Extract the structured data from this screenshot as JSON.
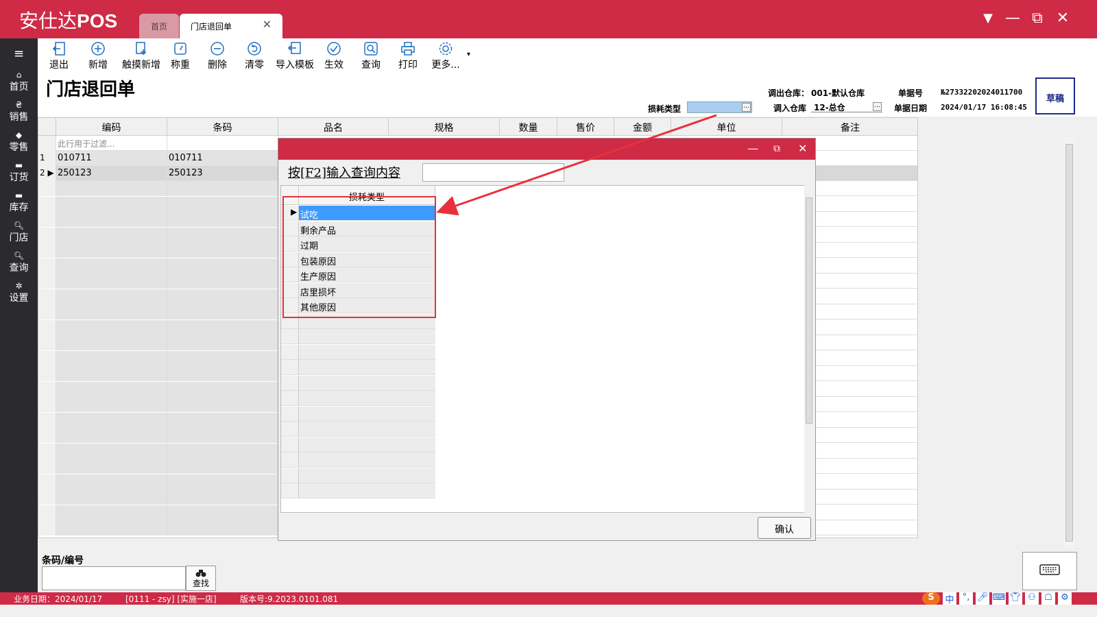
{
  "app": {
    "title_cn": "安仕达",
    "title_en": "POS",
    "tabs": [
      {
        "label": "首页"
      },
      {
        "label": "门店退回单"
      }
    ],
    "tab_close": "✕",
    "window_buttons": {
      "menu": "▼",
      "minimize": "—",
      "restore": "⧉",
      "close": "✕"
    }
  },
  "sidebar": {
    "menu_icon": "≡",
    "items": [
      {
        "label": "首页",
        "icon": "home-icon",
        "glyph": "⌂"
      },
      {
        "label": "销售",
        "icon": "currency-icon",
        "glyph": "₴"
      },
      {
        "label": "零售",
        "icon": "tag-icon",
        "glyph": "◆"
      },
      {
        "label": "订货",
        "icon": "cart-icon",
        "glyph": "▬"
      },
      {
        "label": "库存",
        "icon": "stock-icon",
        "glyph": "▬"
      },
      {
        "label": "门店",
        "icon": "search-store-icon",
        "glyph": "🔍︎"
      },
      {
        "label": "查询",
        "icon": "search-icon",
        "glyph": "🔍︎"
      },
      {
        "label": "设置",
        "icon": "gear-icon",
        "glyph": "✲"
      }
    ]
  },
  "toolbar": {
    "items": [
      {
        "label": "退出",
        "icon": "exit-icon"
      },
      {
        "label": "新增",
        "icon": "add-icon"
      },
      {
        "label": "触摸新增",
        "icon": "touch-add-icon"
      },
      {
        "label": "称重",
        "icon": "scale-icon"
      },
      {
        "label": "删除",
        "icon": "delete-icon"
      },
      {
        "label": "清零",
        "icon": "reset-icon"
      },
      {
        "label": "导入模板",
        "icon": "import-icon"
      },
      {
        "label": "生效",
        "icon": "check-icon"
      },
      {
        "label": "查询",
        "icon": "query-icon"
      },
      {
        "label": "打印",
        "icon": "print-icon"
      },
      {
        "label": "更多...",
        "icon": "more-icon"
      }
    ],
    "more_arrow": "▾"
  },
  "header": {
    "page_title": "门店退回单",
    "loss_type_label": "损耗类型",
    "out_warehouse_label": "调出仓库：",
    "out_warehouse_value": "001-默认仓库",
    "in_warehouse_label": "调入仓库",
    "in_warehouse_value": "12-总仓",
    "doc_no_label": "单据号",
    "doc_no_value": "№27332202024011700",
    "doc_date_label": "单据日期",
    "doc_date_value": "2024/01/17 16:08:45",
    "status_button": "草稿",
    "ellipsis": "..."
  },
  "grid": {
    "columns": [
      "编码",
      "条码",
      "品名",
      "规格",
      "数量",
      "售价",
      "金额",
      "单位",
      "备注"
    ],
    "filter_placeholder": "此行用于过滤...",
    "rows": [
      {
        "num": "1",
        "code": "010711",
        "barcode": "010711"
      },
      {
        "num": "2",
        "code": "250123",
        "barcode": "250123"
      }
    ],
    "current_row_marker": "▶"
  },
  "dialog": {
    "window_buttons": {
      "minimize": "—",
      "restore": "⧉",
      "close": "✕"
    },
    "query_label": "按[F2]输入查询内容",
    "query_value": "",
    "column": "损耗类型",
    "row_marker": "▶",
    "items": [
      "试吃",
      "剩余产品",
      "过期",
      "包装原因",
      "生产原因",
      "店里损坏",
      "其他原因"
    ],
    "selected_index": 0,
    "confirm_button": "确认"
  },
  "bottom": {
    "barcode_label": "条码/编号",
    "barcode_value": "",
    "find_button": "查找",
    "find_icon": "binoculars-icon",
    "keyboard_icon": "keyboard-icon"
  },
  "status": {
    "business_date": "业务日期：2024/01/17",
    "user_store": "[0111 - zsy] [实施一店]",
    "version": "版本号:9.2023.0101.081",
    "tray": [
      "S",
      "中",
      "°,",
      "🎤︎",
      "⌨",
      "👕︎",
      "⚇",
      "☖",
      "⚙"
    ]
  },
  "colors": {
    "brand": "#cf2a46",
    "sidebar": "#2b2b2f",
    "selected_row": "#3d9bff",
    "annotation": "#e8303b",
    "draft_border": "#1a2a8a"
  }
}
